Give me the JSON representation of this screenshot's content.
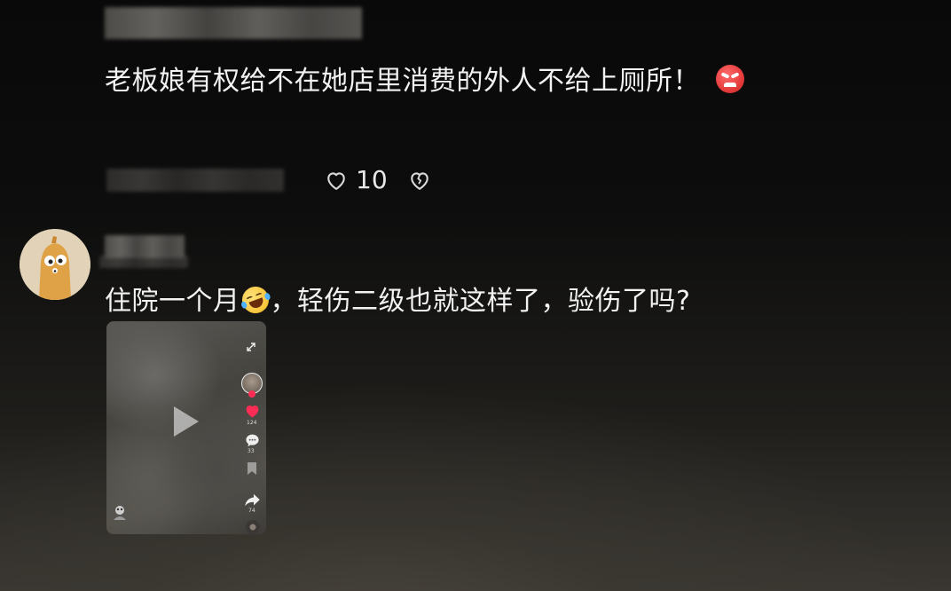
{
  "comment1": {
    "text": "老板娘有权给不在她店里消费的外人不给上厕所！",
    "emoji": "angry-emoji",
    "likes": "10"
  },
  "comment2": {
    "text_before": "住院一个月",
    "emoji": "rolling-laughing-emoji",
    "text_after": "，轻伤二级也就这样了，验伤了吗?",
    "video": {
      "side_like_count": "124",
      "side_comment_count": "33",
      "side_share_count": "74"
    }
  },
  "colors": {
    "text": "#f2f2f2",
    "like_heart": "#ff2d55",
    "angry_emoji": "#e63c3c"
  }
}
